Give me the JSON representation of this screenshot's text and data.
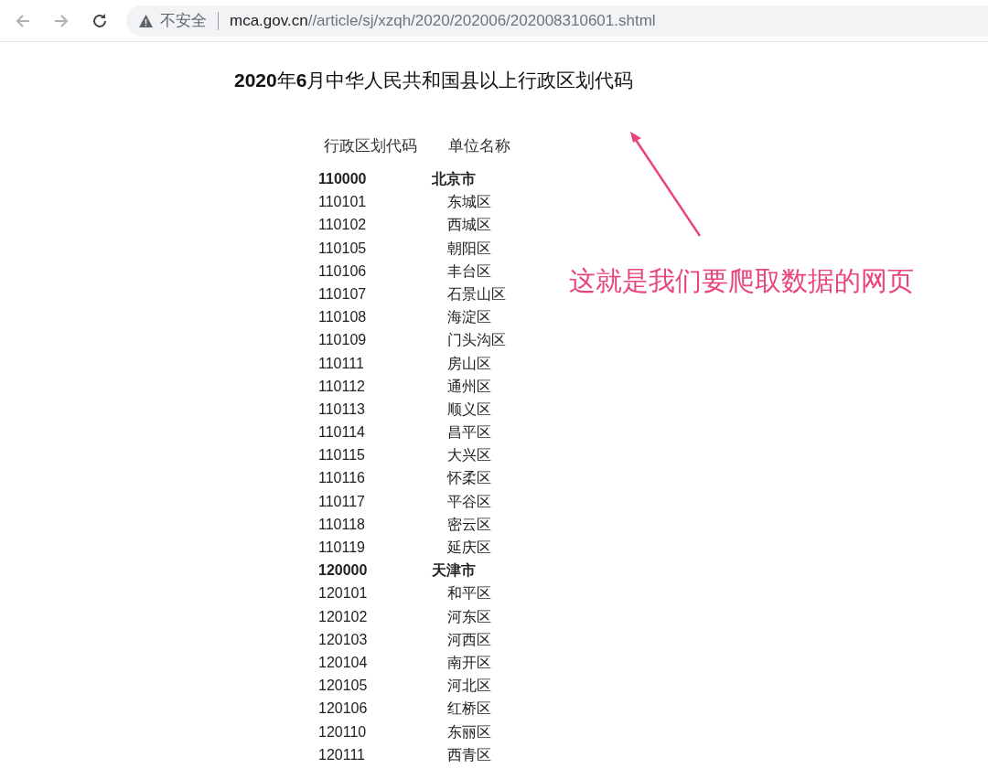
{
  "browser": {
    "security_label": "不安全",
    "url_host": "mca.gov.cn",
    "url_path": "//article/sj/xzqh/2020/202006/202008310601.shtml"
  },
  "page": {
    "title": "**2020**年**6**月中华人民共和国县以上行政区划代码",
    "table": {
      "columns": [
        "行政区划代码",
        "单位名称"
      ],
      "rows": [
        {
          "kind": "province",
          "code": "110000",
          "name": "北京市"
        },
        {
          "kind": "district",
          "code": "110101",
          "name": "东城区"
        },
        {
          "kind": "district",
          "code": "110102",
          "name": "西城区"
        },
        {
          "kind": "district",
          "code": "110105",
          "name": "朝阳区"
        },
        {
          "kind": "district",
          "code": "110106",
          "name": "丰台区"
        },
        {
          "kind": "district",
          "code": "110107",
          "name": "石景山区"
        },
        {
          "kind": "district",
          "code": "110108",
          "name": "海淀区"
        },
        {
          "kind": "district",
          "code": "110109",
          "name": "门头沟区"
        },
        {
          "kind": "district",
          "code": "110111",
          "name": "房山区"
        },
        {
          "kind": "district",
          "code": "110112",
          "name": "通州区"
        },
        {
          "kind": "district",
          "code": "110113",
          "name": "顺义区"
        },
        {
          "kind": "district",
          "code": "110114",
          "name": "昌平区"
        },
        {
          "kind": "district",
          "code": "110115",
          "name": "大兴区"
        },
        {
          "kind": "district",
          "code": "110116",
          "name": "怀柔区"
        },
        {
          "kind": "district",
          "code": "110117",
          "name": "平谷区"
        },
        {
          "kind": "district",
          "code": "110118",
          "name": "密云区"
        },
        {
          "kind": "district",
          "code": "110119",
          "name": "延庆区"
        },
        {
          "kind": "province",
          "code": "120000",
          "name": "天津市"
        },
        {
          "kind": "district",
          "code": "120101",
          "name": "和平区"
        },
        {
          "kind": "district",
          "code": "120102",
          "name": "河东区"
        },
        {
          "kind": "district",
          "code": "120103",
          "name": "河西区"
        },
        {
          "kind": "district",
          "code": "120104",
          "name": "南开区"
        },
        {
          "kind": "district",
          "code": "120105",
          "name": "河北区"
        },
        {
          "kind": "district",
          "code": "120106",
          "name": "红桥区"
        },
        {
          "kind": "district",
          "code": "120110",
          "name": "东丽区"
        },
        {
          "kind": "district",
          "code": "120111",
          "name": "西青区"
        }
      ]
    }
  },
  "annotation": {
    "text": "这就是我们要爬取数据的网页"
  }
}
